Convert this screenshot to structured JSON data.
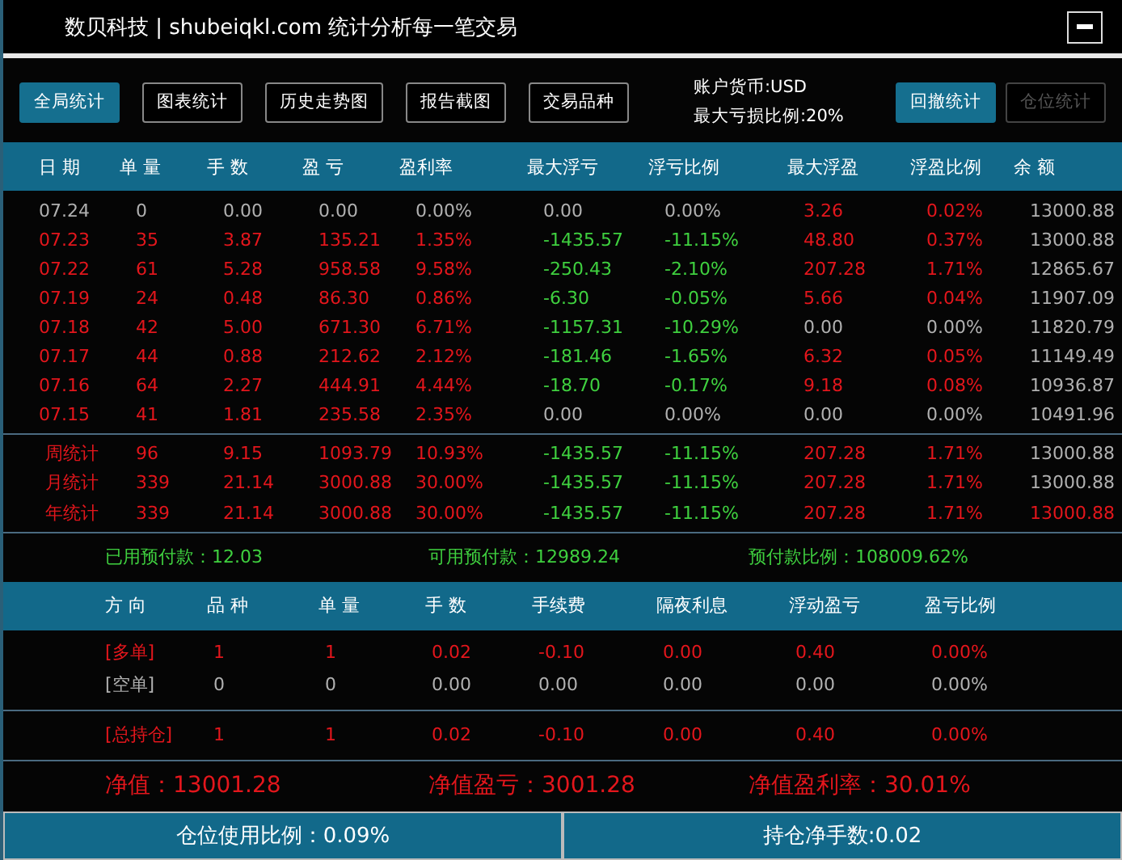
{
  "window": {
    "title": "数贝科技 | shubeiqkl.com 统计分析每一笔交易"
  },
  "toolbar": {
    "left_buttons": [
      {
        "label": "全局统计",
        "selected": true,
        "disabled": false
      },
      {
        "label": "图表统计",
        "selected": false,
        "disabled": false
      },
      {
        "label": "历史走势图",
        "selected": false,
        "disabled": false
      },
      {
        "label": "报告截图",
        "selected": false,
        "disabled": false
      },
      {
        "label": "交易品种",
        "selected": false,
        "disabled": false
      }
    ],
    "account": [
      "账户货币:USD",
      "最大亏损比例:20%"
    ],
    "right_buttons": [
      {
        "label": "回撤统计",
        "selected": true,
        "disabled": false
      },
      {
        "label": "仓位统计",
        "selected": false,
        "disabled": true
      }
    ]
  },
  "daily_table": {
    "columns": [
      "日 期",
      "单 量",
      "手 数",
      "盈 亏",
      "盈利率",
      "最大浮亏",
      "浮亏比例",
      "最大浮盈",
      "浮盈比例",
      "余 额"
    ],
    "rows": [
      {
        "cells": [
          {
            "text": "07.24",
            "color": "#b0b0b0"
          },
          {
            "text": "0",
            "color": "#b0b0b0"
          },
          {
            "text": "0.00",
            "color": "#b0b0b0"
          },
          {
            "text": "0.00",
            "color": "#b0b0b0"
          },
          {
            "text": "0.00%",
            "color": "#b0b0b0"
          },
          {
            "text": "0.00",
            "color": "#b0b0b0"
          },
          {
            "text": "0.00%",
            "color": "#b0b0b0"
          },
          {
            "text": "3.26",
            "color": "#e3161c"
          },
          {
            "text": "0.02%",
            "color": "#e3161c"
          },
          {
            "text": "13000.88",
            "color": "#b0b0b0"
          }
        ]
      },
      {
        "cells": [
          {
            "text": "07.23",
            "color": "#e3161c"
          },
          {
            "text": "35",
            "color": "#e3161c"
          },
          {
            "text": "3.87",
            "color": "#e3161c"
          },
          {
            "text": "135.21",
            "color": "#e3161c"
          },
          {
            "text": "1.35%",
            "color": "#e3161c"
          },
          {
            "text": "-1435.57",
            "color": "#3fd03f"
          },
          {
            "text": "-11.15%",
            "color": "#3fd03f"
          },
          {
            "text": "48.80",
            "color": "#e3161c"
          },
          {
            "text": "0.37%",
            "color": "#e3161c"
          },
          {
            "text": "13000.88",
            "color": "#b0b0b0"
          }
        ]
      },
      {
        "cells": [
          {
            "text": "07.22",
            "color": "#e3161c"
          },
          {
            "text": "61",
            "color": "#e3161c"
          },
          {
            "text": "5.28",
            "color": "#e3161c"
          },
          {
            "text": "958.58",
            "color": "#e3161c"
          },
          {
            "text": "9.58%",
            "color": "#e3161c"
          },
          {
            "text": "-250.43",
            "color": "#3fd03f"
          },
          {
            "text": "-2.10%",
            "color": "#3fd03f"
          },
          {
            "text": "207.28",
            "color": "#e3161c"
          },
          {
            "text": "1.71%",
            "color": "#e3161c"
          },
          {
            "text": "12865.67",
            "color": "#b0b0b0"
          }
        ]
      },
      {
        "cells": [
          {
            "text": "07.19",
            "color": "#e3161c"
          },
          {
            "text": "24",
            "color": "#e3161c"
          },
          {
            "text": "0.48",
            "color": "#e3161c"
          },
          {
            "text": "86.30",
            "color": "#e3161c"
          },
          {
            "text": "0.86%",
            "color": "#e3161c"
          },
          {
            "text": "-6.30",
            "color": "#3fd03f"
          },
          {
            "text": "-0.05%",
            "color": "#3fd03f"
          },
          {
            "text": "5.66",
            "color": "#e3161c"
          },
          {
            "text": "0.04%",
            "color": "#e3161c"
          },
          {
            "text": "11907.09",
            "color": "#b0b0b0"
          }
        ]
      },
      {
        "cells": [
          {
            "text": "07.18",
            "color": "#e3161c"
          },
          {
            "text": "42",
            "color": "#e3161c"
          },
          {
            "text": "5.00",
            "color": "#e3161c"
          },
          {
            "text": "671.30",
            "color": "#e3161c"
          },
          {
            "text": "6.71%",
            "color": "#e3161c"
          },
          {
            "text": "-1157.31",
            "color": "#3fd03f"
          },
          {
            "text": "-10.29%",
            "color": "#3fd03f"
          },
          {
            "text": "0.00",
            "color": "#b0b0b0"
          },
          {
            "text": "0.00%",
            "color": "#b0b0b0"
          },
          {
            "text": "11820.79",
            "color": "#b0b0b0"
          }
        ]
      },
      {
        "cells": [
          {
            "text": "07.17",
            "color": "#e3161c"
          },
          {
            "text": "44",
            "color": "#e3161c"
          },
          {
            "text": "0.88",
            "color": "#e3161c"
          },
          {
            "text": "212.62",
            "color": "#e3161c"
          },
          {
            "text": "2.12%",
            "color": "#e3161c"
          },
          {
            "text": "-181.46",
            "color": "#3fd03f"
          },
          {
            "text": "-1.65%",
            "color": "#3fd03f"
          },
          {
            "text": "6.32",
            "color": "#e3161c"
          },
          {
            "text": "0.05%",
            "color": "#e3161c"
          },
          {
            "text": "11149.49",
            "color": "#b0b0b0"
          }
        ]
      },
      {
        "cells": [
          {
            "text": "07.16",
            "color": "#e3161c"
          },
          {
            "text": "64",
            "color": "#e3161c"
          },
          {
            "text": "2.27",
            "color": "#e3161c"
          },
          {
            "text": "444.91",
            "color": "#e3161c"
          },
          {
            "text": "4.44%",
            "color": "#e3161c"
          },
          {
            "text": "-18.70",
            "color": "#3fd03f"
          },
          {
            "text": "-0.17%",
            "color": "#3fd03f"
          },
          {
            "text": "9.18",
            "color": "#e3161c"
          },
          {
            "text": "0.08%",
            "color": "#e3161c"
          },
          {
            "text": "10936.87",
            "color": "#b0b0b0"
          }
        ]
      },
      {
        "cells": [
          {
            "text": "07.15",
            "color": "#e3161c"
          },
          {
            "text": "41",
            "color": "#e3161c"
          },
          {
            "text": "1.81",
            "color": "#e3161c"
          },
          {
            "text": "235.58",
            "color": "#e3161c"
          },
          {
            "text": "2.35%",
            "color": "#e3161c"
          },
          {
            "text": "0.00",
            "color": "#b0b0b0"
          },
          {
            "text": "0.00%",
            "color": "#b0b0b0"
          },
          {
            "text": "0.00",
            "color": "#b0b0b0"
          },
          {
            "text": "0.00%",
            "color": "#b0b0b0"
          },
          {
            "text": "10491.96",
            "color": "#b0b0b0"
          }
        ]
      }
    ],
    "summary_rows": [
      {
        "cells": [
          {
            "text": "周统计",
            "color": "#e3161c"
          },
          {
            "text": "96",
            "color": "#e3161c"
          },
          {
            "text": "9.15",
            "color": "#e3161c"
          },
          {
            "text": "1093.79",
            "color": "#e3161c"
          },
          {
            "text": "10.93%",
            "color": "#e3161c"
          },
          {
            "text": "-1435.57",
            "color": "#3fd03f"
          },
          {
            "text": "-11.15%",
            "color": "#3fd03f"
          },
          {
            "text": "207.28",
            "color": "#e3161c"
          },
          {
            "text": "1.71%",
            "color": "#e3161c"
          },
          {
            "text": "13000.88",
            "color": "#b0b0b0"
          }
        ]
      },
      {
        "cells": [
          {
            "text": "月统计",
            "color": "#e3161c"
          },
          {
            "text": "339",
            "color": "#e3161c"
          },
          {
            "text": "21.14",
            "color": "#e3161c"
          },
          {
            "text": "3000.88",
            "color": "#e3161c"
          },
          {
            "text": "30.00%",
            "color": "#e3161c"
          },
          {
            "text": "-1435.57",
            "color": "#3fd03f"
          },
          {
            "text": "-11.15%",
            "color": "#3fd03f"
          },
          {
            "text": "207.28",
            "color": "#e3161c"
          },
          {
            "text": "1.71%",
            "color": "#e3161c"
          },
          {
            "text": "13000.88",
            "color": "#b0b0b0"
          }
        ]
      },
      {
        "cells": [
          {
            "text": "年统计",
            "color": "#e3161c"
          },
          {
            "text": "339",
            "color": "#e3161c"
          },
          {
            "text": "21.14",
            "color": "#e3161c"
          },
          {
            "text": "3000.88",
            "color": "#e3161c"
          },
          {
            "text": "30.00%",
            "color": "#e3161c"
          },
          {
            "text": "-1435.57",
            "color": "#3fd03f"
          },
          {
            "text": "-11.15%",
            "color": "#3fd03f"
          },
          {
            "text": "207.28",
            "color": "#e3161c"
          },
          {
            "text": "1.71%",
            "color": "#e3161c"
          },
          {
            "text": "13000.88",
            "color": "#e3161c"
          }
        ]
      }
    ]
  },
  "prepaid": [
    "已用预付款：12.03",
    "可用预付款：12989.24",
    "预付款比例：108009.62%"
  ],
  "positions": {
    "columns": [
      "方 向",
      "品 种",
      "单 量",
      "手 数",
      "手续费",
      "隔夜利息",
      "浮动盈亏",
      "盈亏比例"
    ],
    "rows": [
      {
        "cells": [
          {
            "text": "[多单]",
            "color": "#e3161c"
          },
          {
            "text": "1",
            "color": "#e3161c"
          },
          {
            "text": "1",
            "color": "#e3161c"
          },
          {
            "text": "0.02",
            "color": "#e3161c"
          },
          {
            "text": "-0.10",
            "color": "#e3161c"
          },
          {
            "text": "0.00",
            "color": "#e3161c"
          },
          {
            "text": "0.40",
            "color": "#e3161c"
          },
          {
            "text": "0.00%",
            "color": "#e3161c"
          }
        ]
      },
      {
        "cells": [
          {
            "text": "[空单]",
            "color": "#b0b0b0"
          },
          {
            "text": "0",
            "color": "#b0b0b0"
          },
          {
            "text": "0",
            "color": "#b0b0b0"
          },
          {
            "text": "0.00",
            "color": "#b0b0b0"
          },
          {
            "text": "0.00",
            "color": "#b0b0b0"
          },
          {
            "text": "0.00",
            "color": "#b0b0b0"
          },
          {
            "text": "0.00",
            "color": "#b0b0b0"
          },
          {
            "text": "0.00%",
            "color": "#b0b0b0"
          }
        ]
      }
    ],
    "total": {
      "cells": [
        {
          "text": "[总持仓]",
          "color": "#e3161c"
        },
        {
          "text": "1",
          "color": "#e3161c"
        },
        {
          "text": "1",
          "color": "#e3161c"
        },
        {
          "text": "0.02",
          "color": "#e3161c"
        },
        {
          "text": "-0.10",
          "color": "#e3161c"
        },
        {
          "text": "0.00",
          "color": "#e3161c"
        },
        {
          "text": "0.40",
          "color": "#e3161c"
        },
        {
          "text": "0.00%",
          "color": "#e3161c"
        }
      ]
    }
  },
  "net": [
    "净值：13001.28",
    "净值盈亏：3001.28",
    "净值盈利率：30.01%"
  ],
  "footer": [
    "仓位使用比例：0.09%",
    "持仓净手数:0.02"
  ]
}
